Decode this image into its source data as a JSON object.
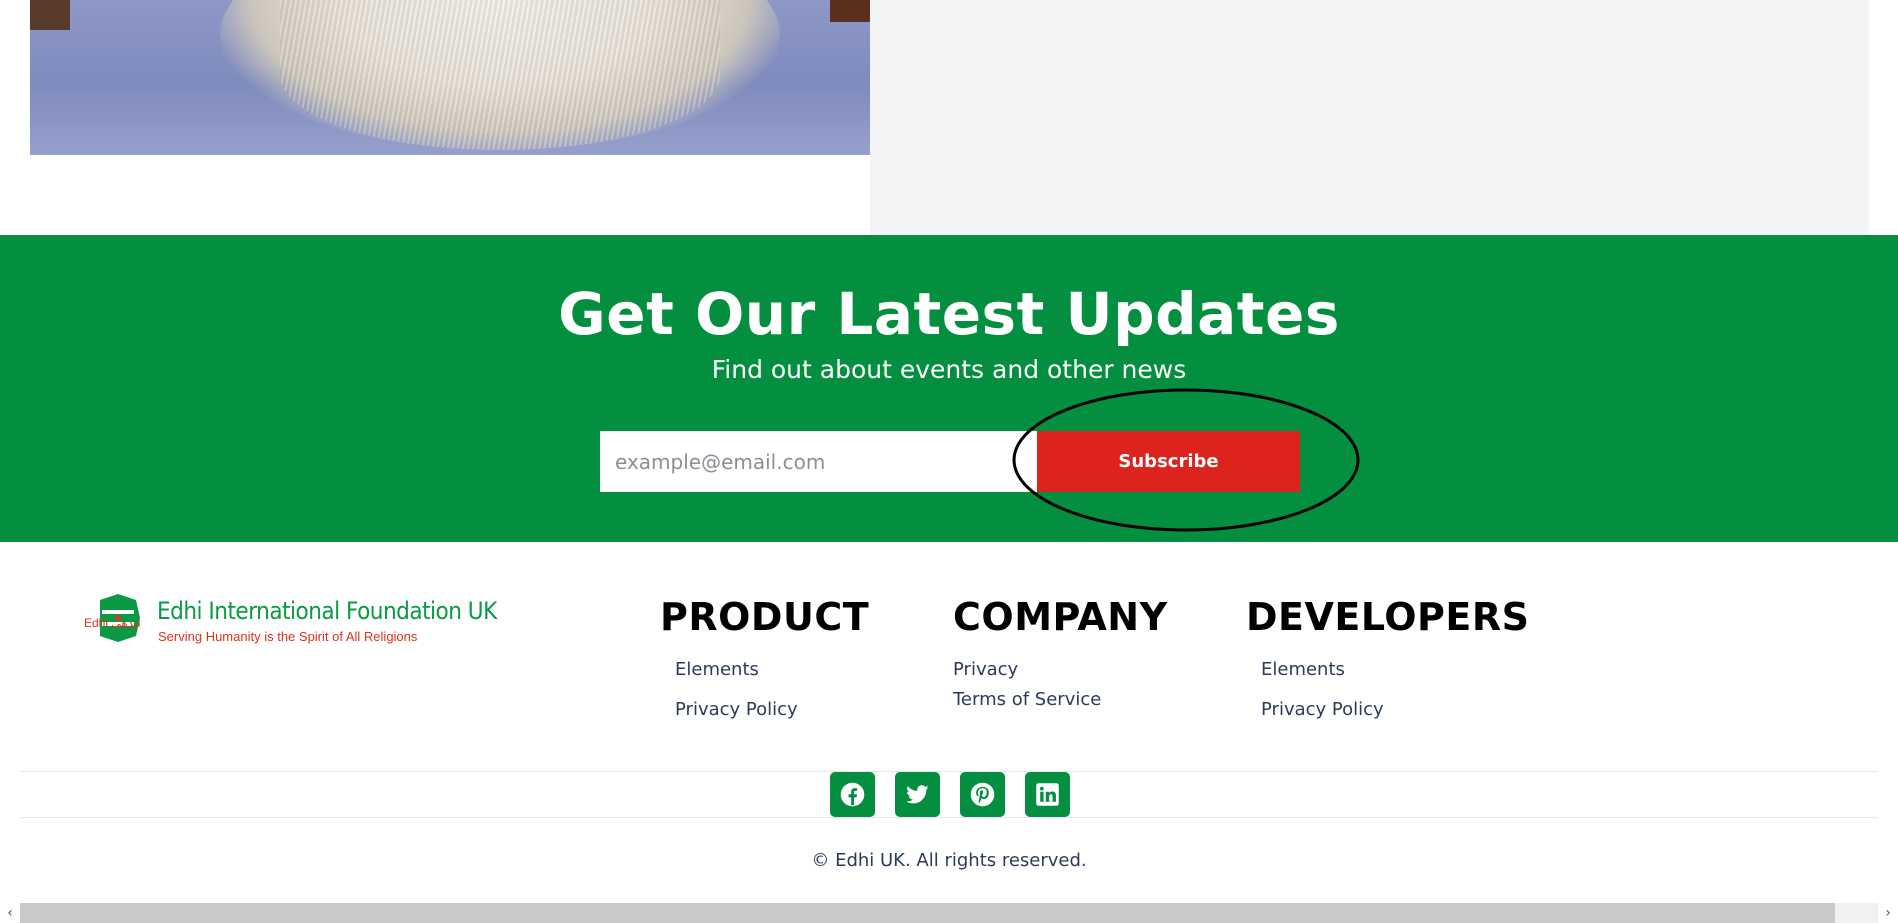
{
  "newsletter": {
    "title": "Get Our Latest Updates",
    "subtitle": "Find out about events and other news",
    "email_placeholder": "example@email.com",
    "subscribe_label": "Subscribe"
  },
  "footer": {
    "logo": {
      "name": "Edhi International Foundation UK",
      "tagline": "Serving Humanity is the Spirit of All Religions",
      "brand_mark": "Edhi ایدھی"
    },
    "columns": [
      {
        "title": "PRODUCT",
        "links": [
          "Elements",
          "Privacy Policy"
        ]
      },
      {
        "title": "COMPANY",
        "links": [
          "Privacy",
          "Terms of Service"
        ]
      },
      {
        "title": "DEVELOPERS",
        "links": [
          "Elements",
          "Privacy Policy"
        ]
      }
    ],
    "social": [
      "facebook-icon",
      "twitter-icon",
      "pinterest-icon",
      "linkedin-icon"
    ],
    "copyright": "© Edhi UK. All rights reserved."
  },
  "colors": {
    "brand_green": "#038f3f",
    "subscribe_red": "#dc231d",
    "panel_grey": "#f3f4f6"
  },
  "scrollbar": {
    "left_arrow": "‹",
    "right_arrow": "›"
  }
}
